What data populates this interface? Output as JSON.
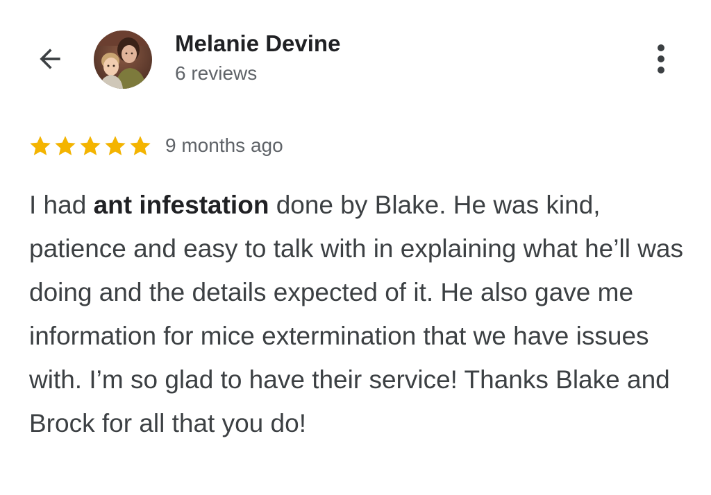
{
  "header": {
    "back_icon": "arrow-back-icon",
    "avatar_icon": "profile-photo",
    "name": "Melanie Devine",
    "reviews": "6 reviews",
    "more_icon": "more-vert-icon"
  },
  "review": {
    "rating": 5,
    "rating_max": 5,
    "star_color": "#f4b400",
    "time": "9 months ago",
    "text_before": "I had ",
    "text_bold": "ant infestation",
    "text_after": " done by Blake. He was kind, patience and easy to talk with in explaining what he’ll was doing and the details expected of it. He also gave me information for mice extermination that we have issues with. I’m so glad to have their service! Thanks Blake and Brock for all that you do!"
  }
}
